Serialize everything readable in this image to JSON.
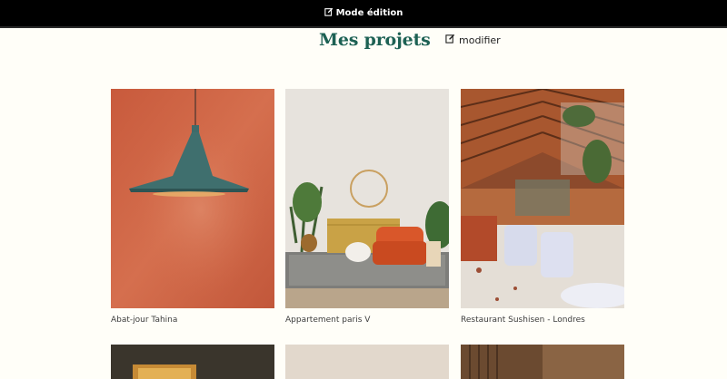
{
  "edit_bar": {
    "label": "Mode édition"
  },
  "header": {
    "title": "Mes projets",
    "modify_label": "modifier"
  },
  "projects": [
    {
      "caption": "Abat-jour Tahina",
      "image": "pendant-lamp-orange-wall"
    },
    {
      "caption": "Appartement paris V",
      "image": "living-room-orange-armchair"
    },
    {
      "caption": "Restaurant Sushisen - Londres",
      "image": "restaurant-interior-wood-ceiling"
    }
  ],
  "colors": {
    "accent": "#1D6154",
    "background": "#FFFEF8",
    "bar": "#000000"
  }
}
